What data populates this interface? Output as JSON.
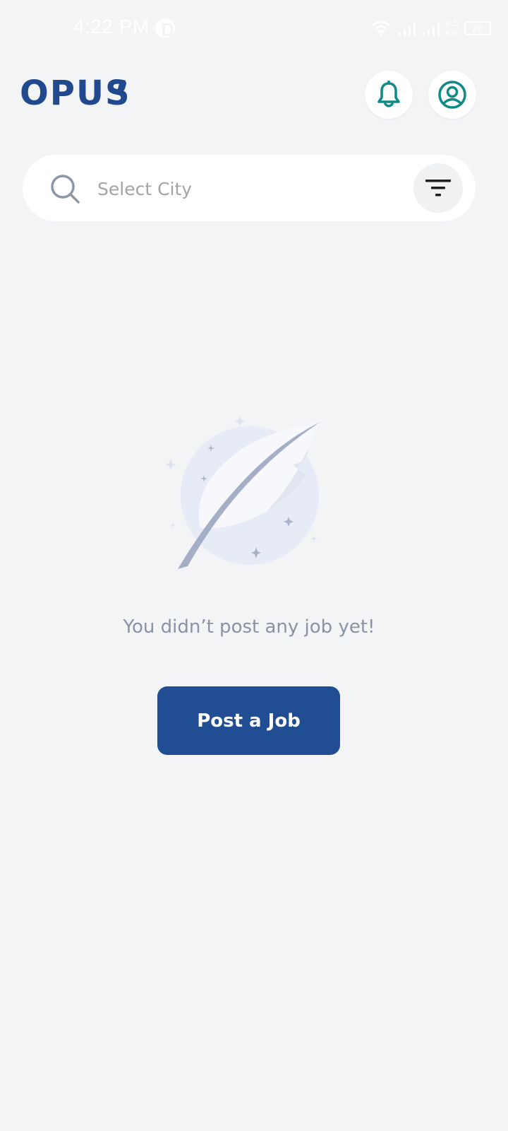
{
  "status_bar": {
    "time": "4:22 PM",
    "network_speed_value": "8.5",
    "network_speed_unit": "K/s",
    "battery_level": "26"
  },
  "header": {
    "logo_text": "OPUS",
    "icons": {
      "notifications": "bell-icon",
      "profile": "user-circle-icon"
    }
  },
  "search": {
    "placeholder": "Select City",
    "value": "",
    "icons": {
      "search": "search-icon",
      "filter": "filter-icon"
    }
  },
  "empty_state": {
    "illustration": "feather-quill-illustration",
    "message": "You didn’t post any job yet!",
    "button_label": "Post a Job"
  },
  "colors": {
    "background": "#f3f4f6",
    "brand_blue": "#21498d",
    "button_blue": "#214d92",
    "icon_teal": "#0f8a86",
    "muted_text": "#8a93a3"
  }
}
